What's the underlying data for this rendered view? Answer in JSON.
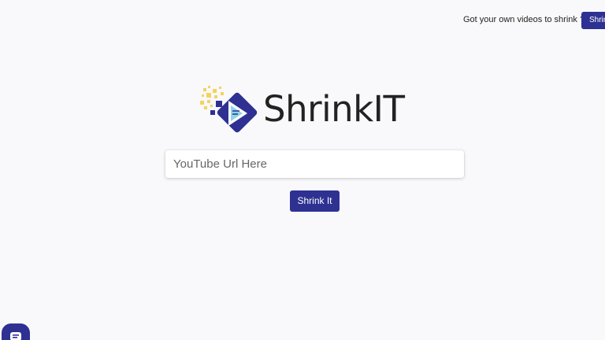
{
  "header": {
    "prompt_text": "Got your own videos to shrink ?",
    "button_label": "Shrink Yours"
  },
  "brand": {
    "name": "ShrinkIT",
    "accent_color": "#2e3192",
    "dot_color": "#f4d35e"
  },
  "search": {
    "placeholder": "YouTube Url Here",
    "value": ""
  },
  "actions": {
    "shrink_label": "Shrink It"
  },
  "widgets": {
    "chat_icon": "chat-icon"
  }
}
